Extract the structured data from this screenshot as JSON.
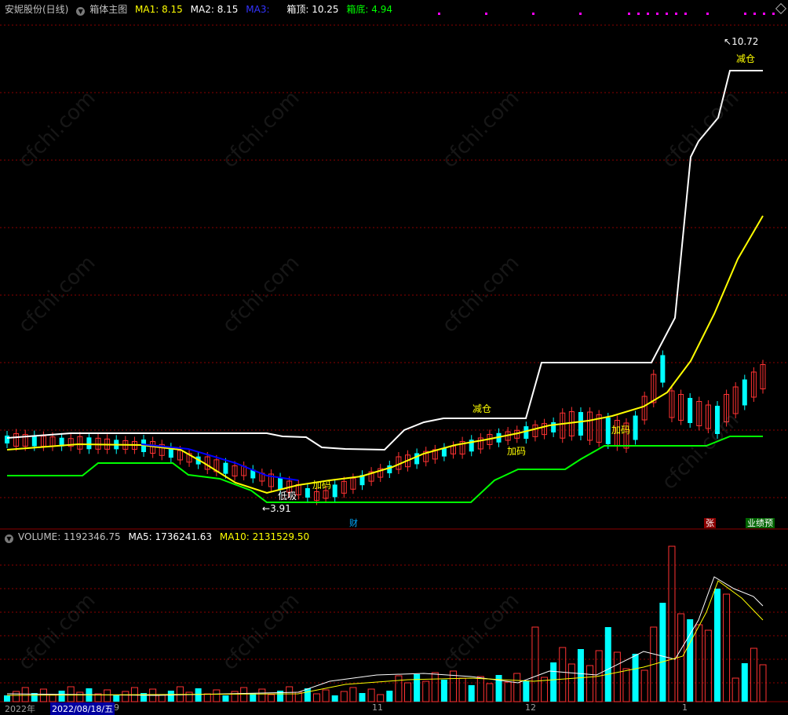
{
  "main_panel": {
    "stock_title": "安妮股份(日线)",
    "indicator_name": "箱体主图",
    "ma1": {
      "label": "MA1: 8.15",
      "color": "#ffff00"
    },
    "ma2": {
      "label": "MA2: 8.15",
      "color": "#ffffff"
    },
    "ma3": {
      "label": "MA3:",
      "color": "#0000ff"
    },
    "box_top": {
      "label": "箱顶: 10.25",
      "color": "#ffffff"
    },
    "box_bottom": {
      "label": "箱底: 4.94",
      "color": "#00ff00"
    }
  },
  "annotations": {
    "high_price": "10.72",
    "low_price": "3.91",
    "reduce_1": "减仓",
    "reduce_2": "减仓",
    "add_1": "加码",
    "add_2": "加码",
    "add_3": "加码",
    "bottom_buy": "低吸"
  },
  "event_tags": {
    "fin": "财",
    "zhang": "张",
    "forecast": "业绩预"
  },
  "volume_panel": {
    "volume": "VOLUME: 1192346.75",
    "ma5": "MA5: 1736241.63",
    "ma10": "MA10: 2131529.50"
  },
  "date_axis": {
    "year_start": "2022年",
    "cursor_date": "2022/08/18/五",
    "m9": "9",
    "m11": "11",
    "m12": "12",
    "m1": "1"
  },
  "watermark": "cfchi.com",
  "colors": {
    "up": "#ff3232",
    "down": "#00ffff",
    "ma_yellow": "#ffff00",
    "box_top_white": "#ffffff",
    "box_bottom_green": "#00ff00",
    "ma3_blue": "#0000ff",
    "grid": "#8b0000",
    "vol_ma5": "#ffffff",
    "vol_ma10": "#ffff00"
  }
}
